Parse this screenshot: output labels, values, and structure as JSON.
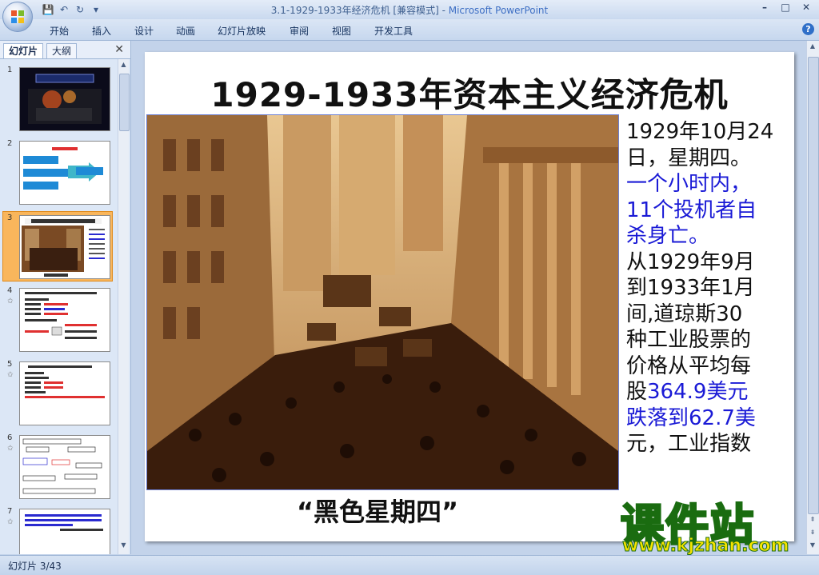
{
  "window": {
    "title": "3.1-1929-1933年经济危机 [兼容模式] - ",
    "app_name": "Microsoft PowerPoint",
    "controls": [
      "–",
      "□",
      "✕"
    ]
  },
  "ribbon": {
    "tabs": [
      "开始",
      "插入",
      "设计",
      "动画",
      "幻灯片放映",
      "审阅",
      "视图",
      "开发工具"
    ]
  },
  "left_pane": {
    "tabs": [
      "幻灯片",
      "大纲"
    ],
    "slides": [
      {
        "num": "1",
        "star": ""
      },
      {
        "num": "2",
        "star": ""
      },
      {
        "num": "3",
        "star": ""
      },
      {
        "num": "4",
        "star": "✩"
      },
      {
        "num": "5",
        "star": "✩"
      },
      {
        "num": "6",
        "star": "✩"
      },
      {
        "num": "7",
        "star": "✩"
      }
    ],
    "selected_slide": 3
  },
  "slide": {
    "title": "1929-1933年资本主义经济危机",
    "text_lines": [
      {
        "text": "1929年10月24",
        "blue": false
      },
      {
        "text": "日，星期四。",
        "blue": false
      },
      {
        "text": "一个小时内，",
        "blue": true
      },
      {
        "text": "11个投机者自",
        "blue": true
      },
      {
        "text": "杀身亡。",
        "blue": true
      },
      {
        "text": "从1929年9月",
        "blue": false
      },
      {
        "text": "到1933年1月",
        "blue": false
      },
      {
        "text": "间,道琼斯30",
        "blue": false
      },
      {
        "text": "种工业股票的",
        "blue": false
      },
      {
        "text": "价格从平均每",
        "blue": false
      }
    ],
    "line_11_a": "股",
    "line_11_b": "364.9美元",
    "line_12": "跌落到62.7美",
    "line_13_a": "元，工业指数",
    "caption": "“黑色星期四”"
  },
  "watermark": {
    "title": "课件站",
    "url": "www.kjzhan.com"
  },
  "statusbar": {
    "text": "幻灯片 3/43"
  }
}
